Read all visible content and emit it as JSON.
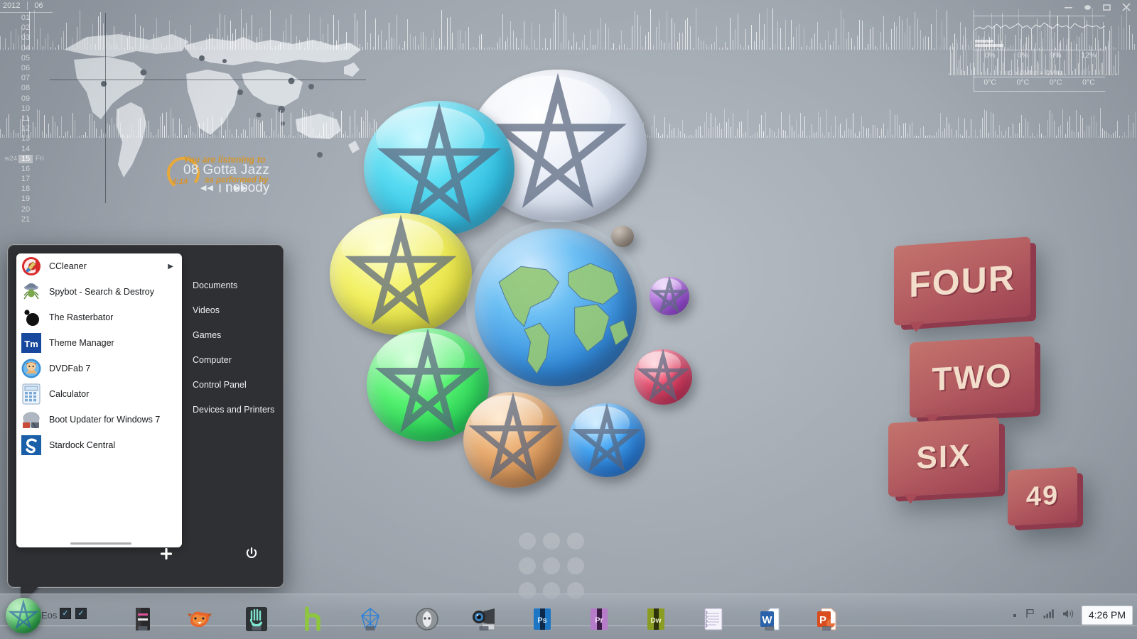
{
  "desktop": {
    "theme_name": "Eos",
    "wallpaper": "orb-cluster-planets"
  },
  "date_sidebar": {
    "year": "2012",
    "month": "06",
    "week_label": "w24",
    "selected_day": "15",
    "selected_weekday": "Fri",
    "days": [
      "01",
      "02",
      "03",
      "04",
      "05",
      "06",
      "07",
      "08",
      "09",
      "10",
      "11",
      "12",
      "13",
      "14",
      "15",
      "16",
      "17",
      "18",
      "19",
      "20",
      "21"
    ]
  },
  "now_playing": {
    "line1": "You are listening to",
    "track": "08 Gotta Jazz",
    "line3": "as performed by",
    "artist": "nobody",
    "elapsed": "4:14",
    "controls": "◀◀ ❙❙ ▶▶"
  },
  "sys_monitor": {
    "cpu_percents": [
      "0%",
      "0%",
      "9%",
      "12%"
    ],
    "temperatures": [
      "0°C",
      "0°C",
      "0°C",
      "0°C"
    ],
    "clock_line": "0 x 0Mhz = 0Mhz",
    "window_controls": [
      "minimize-icon",
      "restore-icon",
      "maximize-icon",
      "close-icon"
    ]
  },
  "clock_widget": {
    "bubbles": [
      "FOUR",
      "TWO",
      "SIX",
      "49"
    ]
  },
  "start_menu": {
    "programs": [
      {
        "label": "CCleaner",
        "icon": "ccleaner-icon",
        "has_submenu": true
      },
      {
        "label": "Spybot - Search & Destroy",
        "icon": "spybot-icon",
        "has_submenu": false
      },
      {
        "label": "The Rasterbator",
        "icon": "rasterbator-icon",
        "has_submenu": false
      },
      {
        "label": "Theme Manager",
        "icon": "theme-manager-icon",
        "has_submenu": false
      },
      {
        "label": "DVDFab 7",
        "icon": "dvdfab-icon",
        "has_submenu": false
      },
      {
        "label": "Calculator",
        "icon": "calculator-icon",
        "has_submenu": false
      },
      {
        "label": "Boot Updater for Windows 7",
        "icon": "boot-updater-icon",
        "has_submenu": false
      },
      {
        "label": "Stardock Central",
        "icon": "stardock-icon",
        "has_submenu": false
      }
    ],
    "links": [
      "Documents",
      "Videos",
      "Games",
      "Computer",
      "Control Panel",
      "Devices and Printers"
    ],
    "footer": {
      "add_icon": "plus-icon",
      "power_icon": "power-icon"
    },
    "submenu_arrow": "▶"
  },
  "taskbar": {
    "start_label": "Eos",
    "quick_checks": [
      "✓",
      "✓"
    ],
    "apps": [
      {
        "name": "pc-tower-icon",
        "running": true
      },
      {
        "name": "firefox-icon",
        "running": false
      },
      {
        "name": "hand-app-icon",
        "running": true
      },
      {
        "name": "h-app-icon",
        "running": false
      },
      {
        "name": "wireframe-icon",
        "running": true
      },
      {
        "name": "foobar2000-icon",
        "running": false
      },
      {
        "name": "webcam-icon",
        "running": true
      },
      {
        "name": "photoshop-icon",
        "running": false
      },
      {
        "name": "premiere-icon",
        "running": false
      },
      {
        "name": "dreamweaver-icon",
        "running": false
      },
      {
        "name": "notepad-icon",
        "running": false
      },
      {
        "name": "word-icon",
        "running": true
      },
      {
        "name": "powerpoint-icon",
        "running": true
      }
    ],
    "tray": {
      "icons": [
        "hidden-icon",
        "action-flag-icon",
        "network-icon",
        "volume-icon"
      ],
      "time": "4:26 PM"
    }
  },
  "colors": {
    "accent_orange": "#d3962f",
    "menu_bg": "#2e3033",
    "bubble_red": "#b55f62",
    "start_green": "#2fa84c"
  }
}
